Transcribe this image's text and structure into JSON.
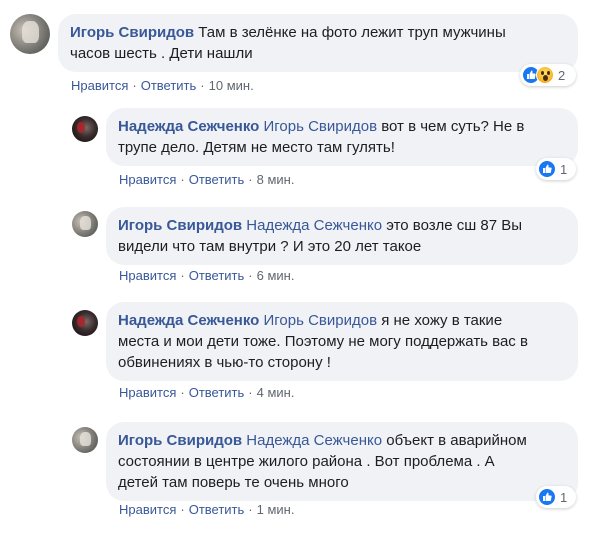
{
  "comments": [
    {
      "author": "Игорь Свиридов",
      "mention": "",
      "lines": [
        "Там в зелёнке на фото лежит труп мужчины",
        "часов шесть . Дети нашли"
      ],
      "like_label": "Нравится",
      "reply_label": "Ответить",
      "time": "10 мин.",
      "reaction_count": "2",
      "reactions": [
        "like-icon",
        "wow-icon"
      ]
    },
    {
      "author": "Надежда Сежченко",
      "mention": "Игорь Свиридов",
      "lines": [
        "вот в чем суть? Не в",
        "трупе дело. Детям не место там гулять!"
      ],
      "like_label": "Нравится",
      "reply_label": "Ответить",
      "time": "8 мин.",
      "reaction_count": "1",
      "reactions": [
        "like-icon"
      ]
    },
    {
      "author": "Игорь Свиридов",
      "mention": "Надежда Сежченко",
      "lines": [
        "это возле сш 87 Вы",
        "видели что там внутри ? И это 20 лет такое"
      ],
      "like_label": "Нравится",
      "reply_label": "Ответить",
      "time": "6 мин.",
      "reaction_count": "",
      "reactions": []
    },
    {
      "author": "Надежда Сежченко",
      "mention": "Игорь Свиридов",
      "lines": [
        "я не хожу в такие",
        "места и мои дети тоже. Поэтому не могу поддержать вас в",
        "обвинениях в чью-то сторону !"
      ],
      "like_label": "Нравится",
      "reply_label": "Ответить",
      "time": "4 мин.",
      "reaction_count": "",
      "reactions": []
    },
    {
      "author": "Игорь Свиридов",
      "mention": "Надежда Сежченко",
      "lines": [
        "объект в аварийном",
        "состоянии в центре жилого района . Вот проблема . А",
        "детей там поверь те очень много"
      ],
      "like_label": "Нравится",
      "reply_label": "Ответить",
      "time": "1 мин.",
      "reaction_count": "1",
      "reactions": [
        "like-icon"
      ]
    }
  ],
  "colors": {
    "name_link": "#385898",
    "bubble_bg": "#f0f2f5",
    "like_blue": "#1877f2",
    "meta_gray": "#606770"
  }
}
